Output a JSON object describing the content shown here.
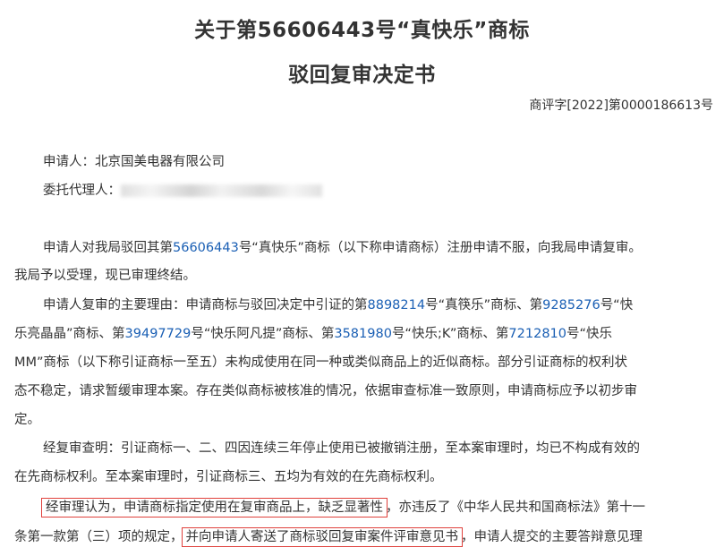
{
  "title_line1": "关于第56606443号“真快乐”商标",
  "title_line2": "驳回复审决定书",
  "ref_no": "商评字[2022]第0000186613号",
  "applicant_label": "申请人：",
  "applicant_name": "北京国美电器有限公司",
  "agent_label": "委托代理人：",
  "p1": {
    "a": "申请人对我局驳回其第",
    "mark_no": "56606443",
    "b": "号“真快乐”商标（以下称申请商标）注册申请不服，向我局申请复审。",
    "c": "我局予以受理，现已审理终结。"
  },
  "p2": {
    "a": "申请人复审的主要理由：申请商标与驳回决定中引证的第",
    "n1": "8898214",
    "b": "号“真筷乐”商标、第",
    "n2": "9285276",
    "c": "号“快",
    "d": "乐亮晶晶”商标、第",
    "n3": "39497729",
    "e": "号“快乐阿凡提”商标、第",
    "n4": "3581980",
    "f": "号“快乐;K”商标、第",
    "n5": "7212810",
    "g": "号“快乐",
    "h": "MM”商标（以下称引证商标一至五）未构成使用在同一种或类似商品上的近似商标。部分引证商标的权利状",
    "i": "态不稳定，请求暂缓审理本案。存在类似商标被核准的情况，依据审查标准一致原则，申请商标应予以初步审",
    "j": "定。"
  },
  "p3": {
    "a": "经复审查明：引证商标一、二、四因连续三年停止使用已被撤销注册，至本案审理时，均已不构成有效的",
    "b": "在先商标权利。至本案审理时，引证商标三、五均为有效的在先商标权利。"
  },
  "p4": {
    "boxed1": "经审理认为，申请商标指定使用在复审商品上，缺乏显著性",
    "a": "，亦违反了《中华人民共和国商标法》第十一",
    "b": "条第一款第（三）项的规定，",
    "boxed2": "并向申请人寄送了商标驳回复审案件评审意见书",
    "c": "，申请人提交的主要答辩意见理"
  }
}
